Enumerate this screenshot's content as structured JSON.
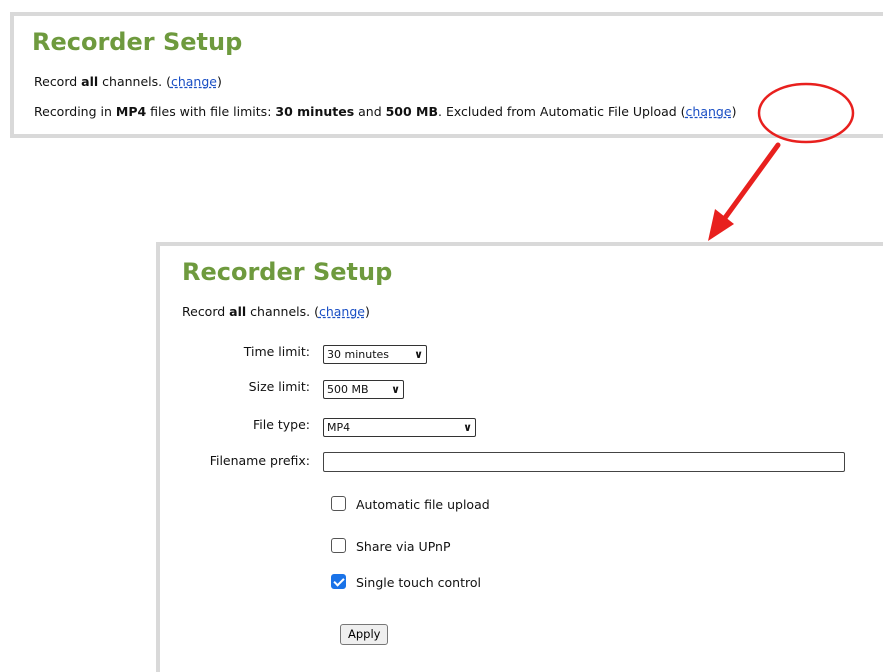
{
  "summary_panel": {
    "title": "Recorder Setup",
    "record_prefix": "Record ",
    "record_all": "all",
    "record_suffix": " channels.  (",
    "change_label": "change",
    "record_close": ")",
    "rec_text_1": "Recording in ",
    "rec_format": "MP4",
    "rec_text_2": " files with file limits: ",
    "rec_time": "30 minutes",
    "rec_text_3": " and ",
    "rec_size": "500 MB",
    "rec_text_4": ". Excluded from Automatic File Upload  (",
    "rec_change_label": "change",
    "rec_close": ")"
  },
  "settings_panel": {
    "title": "Recorder Setup",
    "record_prefix": "Record ",
    "record_all": "all",
    "record_suffix": " channels.  (",
    "change_label": "change",
    "record_close": ")",
    "time_limit_label": "Time limit:",
    "time_limit_value": "30 minutes",
    "size_limit_label": "Size limit:",
    "size_limit_value": "500 MB",
    "file_type_label": "File type:",
    "file_type_value": "MP4",
    "filename_prefix_label": "Filename prefix:",
    "filename_prefix_value": "",
    "checkboxes": [
      {
        "label": "Automatic file upload",
        "checked": false
      },
      {
        "label": "Share via UPnP",
        "checked": false
      },
      {
        "label": "Single touch control",
        "checked": true
      }
    ],
    "apply_label": "Apply"
  },
  "annotation_color": "#e8201e"
}
